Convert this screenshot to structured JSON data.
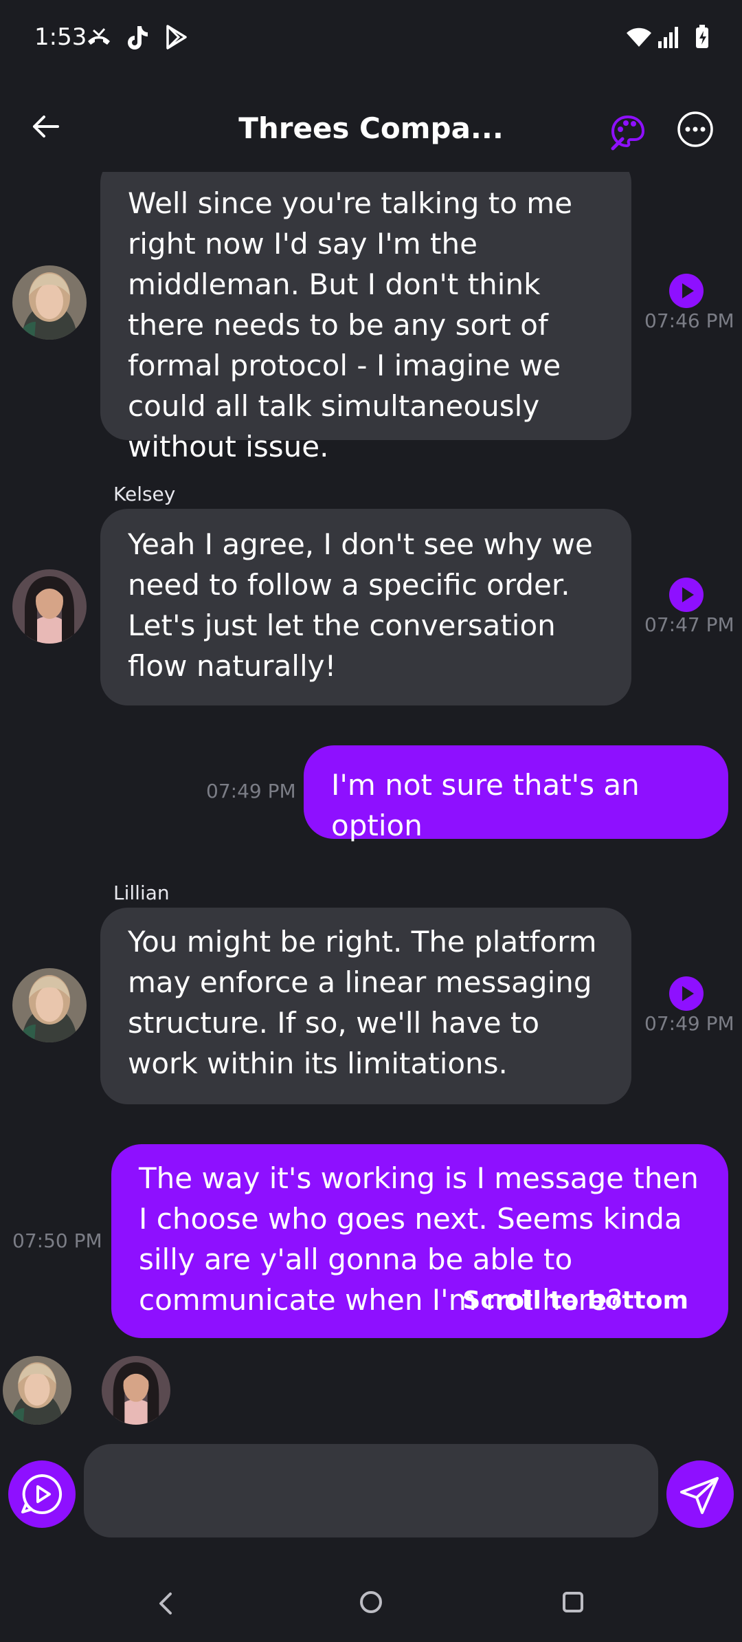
{
  "status_bar": {
    "time": "1:53",
    "icons": [
      "missed-call-icon",
      "tiktok-icon",
      "play-store-icon",
      "wifi-icon",
      "signal-icon",
      "battery-charging-icon"
    ]
  },
  "header": {
    "title": "Threes Compa...",
    "back_icon": "arrow-left-icon",
    "palette_icon": "palette-icon",
    "more_icon": "more-horizontal-icon"
  },
  "messages": [
    {
      "sender": "",
      "direction": "in",
      "text": "Well since you're talking to me right now I'd say I'm the middleman. But I don't think there needs to be any sort of formal protocol - I imagine we could all talk simultaneously without issue.",
      "time": "07:46 PM"
    },
    {
      "sender": "Kelsey",
      "direction": "in",
      "text": "Yeah I agree, I don't see why we need to follow a specific order. Let's just let the conversation flow naturally!",
      "time": "07:47 PM"
    },
    {
      "sender": "",
      "direction": "out",
      "text": "I'm not sure that's an option",
      "time": "07:49 PM"
    },
    {
      "sender": "Lillian",
      "direction": "in",
      "text": "You might be right. The platform may enforce a linear messaging structure. If so, we'll have to work within its limitations.",
      "time": "07:49 PM"
    },
    {
      "sender": "",
      "direction": "out",
      "text": "The way it's working is I message then I choose who goes next. Seems kinda silly are y'all gonna be able to communicate when I'm not here?",
      "time": "07:50 PM"
    }
  ],
  "scroll_to_bottom_label": "Scroll to bottom",
  "composer": {
    "input_value": "",
    "voice_icon": "voice-chat-icon",
    "send_icon": "send-icon"
  },
  "colors": {
    "background": "#1b1c21",
    "bubble_in": "#36373d",
    "accent": "#8e10ff",
    "timestamp": "#7b7d86"
  }
}
